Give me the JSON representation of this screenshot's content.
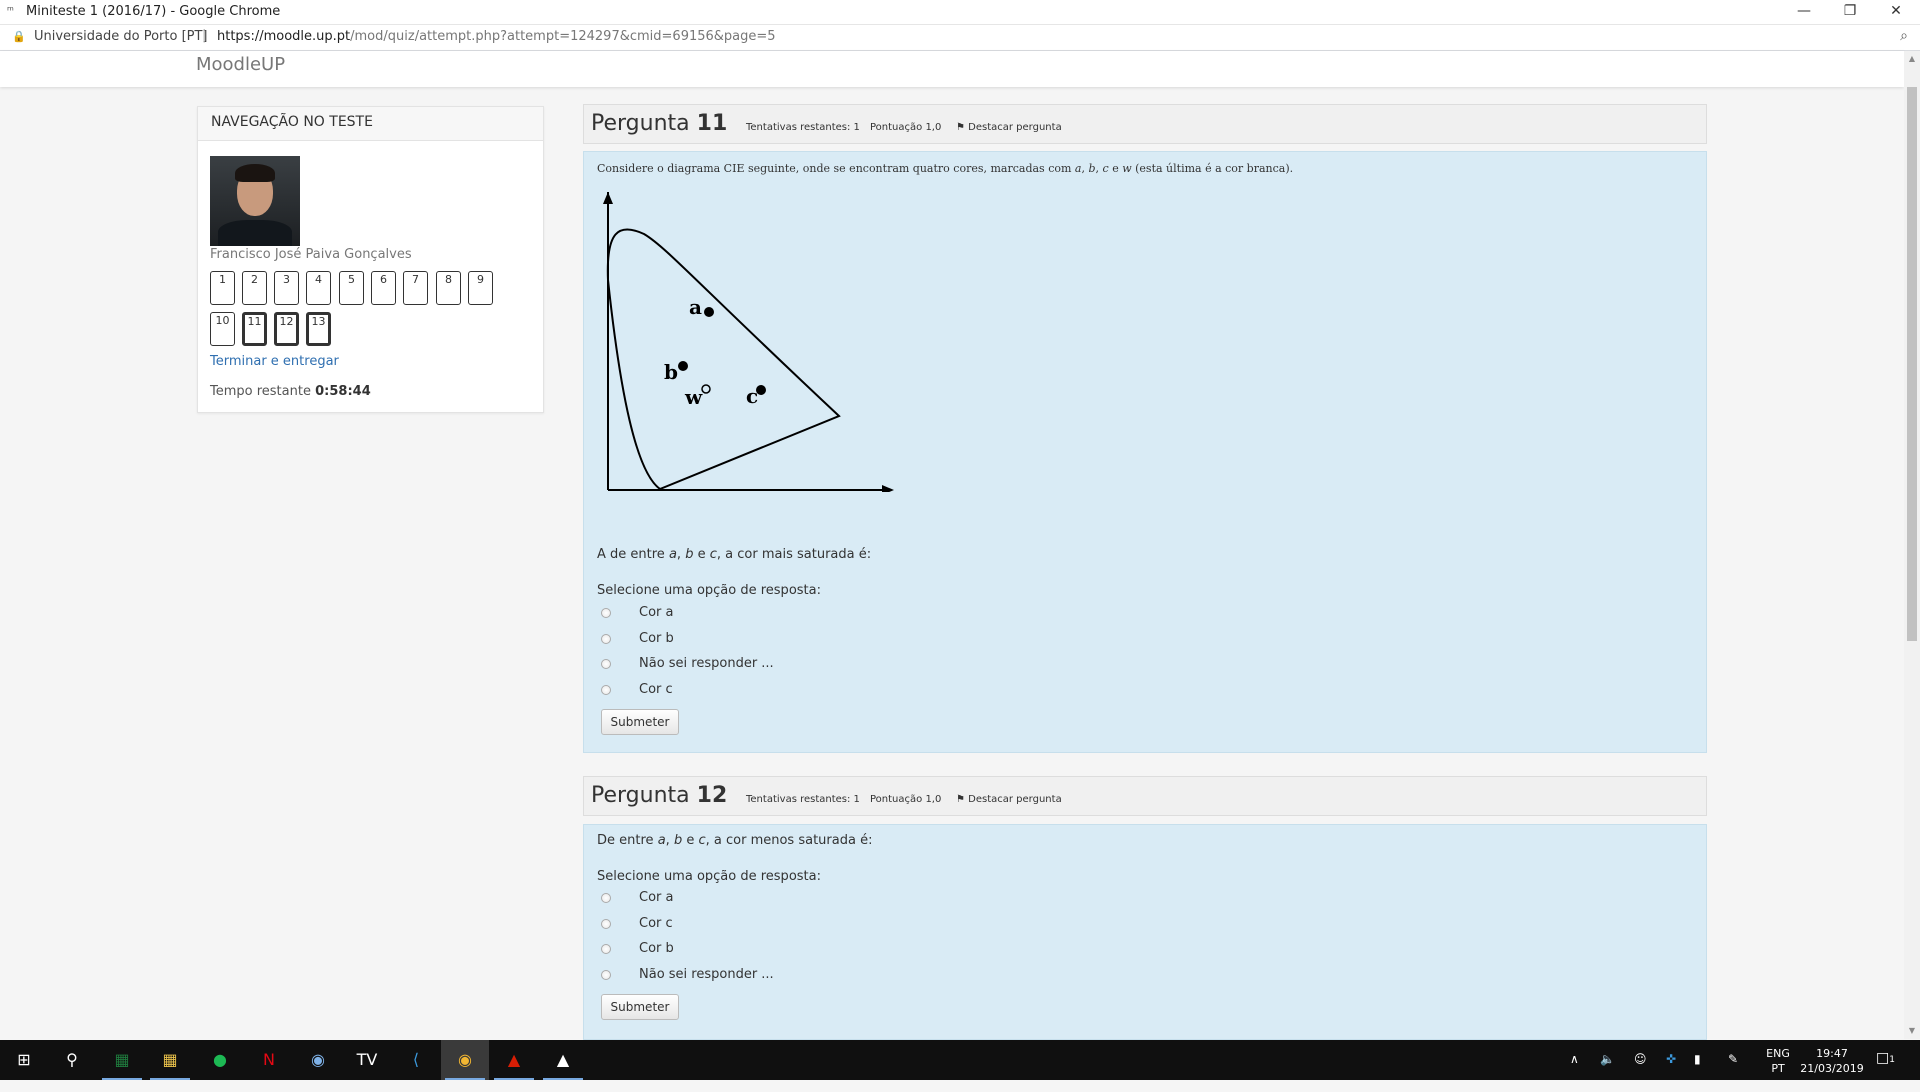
{
  "window": {
    "title": "Miniteste 1 (2016/17) - Google Chrome"
  },
  "address": {
    "site": "Universidade do Porto [PT]",
    "url_host": "https://moodle.up.pt",
    "url_path": "/mod/quiz/attempt.php?attempt=124297&cmid=69156&page=5"
  },
  "nav": {
    "brand": "MoodleUP"
  },
  "sidebar": {
    "heading": "NAVEGAÇÃO NO TESTE",
    "username": "Francisco José Paiva Gonçalves",
    "questions": [
      "1",
      "2",
      "3",
      "4",
      "5",
      "6",
      "7",
      "8",
      "9",
      "10",
      "11",
      "12",
      "13"
    ],
    "finish_link": "Terminar e entregar",
    "timer_label": "Tempo restante",
    "timer_value": "0:58:44"
  },
  "q11": {
    "label": "Pergunta",
    "number": "11",
    "attempts": "Tentativas restantes: 1",
    "score": "Pontuação 1,0",
    "flag": "Destacar pergunta",
    "intro_a": "Considere o diagrama CIE seguinte, onde se encontram quatro cores, marcadas com",
    "intro_b": "(esta última é a cor branca).",
    "var_a": "a",
    "var_b": "b",
    "var_c": "c",
    "var_w": "w",
    "and": "e",
    "comma": ",",
    "diagram_labels": {
      "a": "a",
      "b": "b",
      "c": "c",
      "w": "w"
    },
    "prompt_a": "A de entre",
    "prompt_b": ", a cor mais saturada é:",
    "select_label": "Selecione uma opção de resposta:",
    "options": [
      "Cor a",
      "Cor b",
      "Não sei responder ...",
      "Cor c"
    ],
    "submit": "Submeter"
  },
  "q12": {
    "label": "Pergunta",
    "number": "12",
    "attempts": "Tentativas restantes: 1",
    "score": "Pontuação 1,0",
    "flag": "Destacar pergunta",
    "prompt_a": "De entre",
    "prompt_b": ", a cor menos saturada é:",
    "var_a": "a",
    "var_b": "b",
    "var_c": "c",
    "and": "e",
    "comma": ",",
    "select_label": "Selecione uma opção de resposta:",
    "options": [
      "Cor a",
      "Cor c",
      "Cor b",
      "Não sei responder ..."
    ],
    "submit": "Submeter"
  },
  "taskbar": {
    "apps": [
      "windows-start",
      "search",
      "excel",
      "file-explorer",
      "spotify",
      "netflix",
      "chat",
      "tv",
      "vscode",
      "chrome",
      "acrobat",
      "photos"
    ],
    "lang_top": "ENG",
    "lang_bottom": "PT",
    "time": "19:47",
    "date": "21/03/2019",
    "notifications": "1"
  }
}
